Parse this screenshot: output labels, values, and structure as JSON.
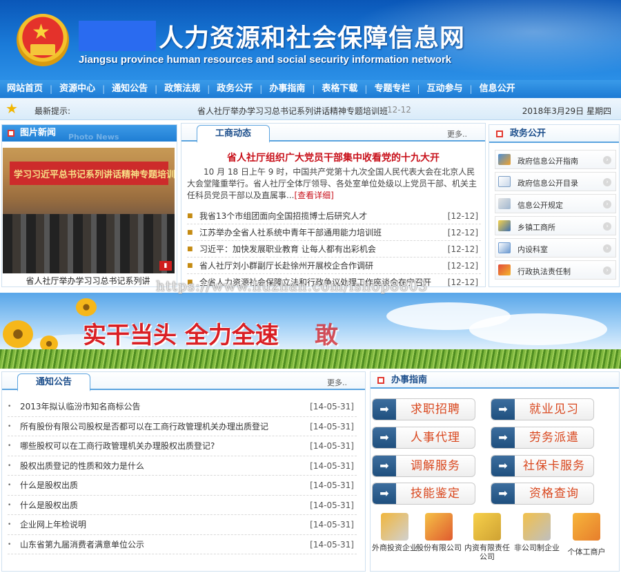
{
  "header": {
    "title": "人力资源和社会保障信息网",
    "subtitle": "Jiangsu province human resources and social security information network"
  },
  "nav": [
    "网站首页",
    "资源中心",
    "通知公告",
    "政策法规",
    "政务公开",
    "办事指南",
    "表格下载",
    "专题专栏",
    "互动参与",
    "信息公开"
  ],
  "ticker": {
    "label": "最新提示:",
    "news": "省人社厅举办学习习总书记系列讲话精神专题培训班",
    "news_date": "12-12",
    "today": "2018年3月29日 星期四"
  },
  "photo_news": {
    "title": "图片新闻",
    "title_en": "Photo News",
    "banner_text": "学习习近平总书记系列讲话精神专题培训班",
    "caption": "省人社厅举办学习习总书记系列讲"
  },
  "gongshang": {
    "title": "工商动态",
    "more": "更多..",
    "headline": "省人社厅组织广大党员干部集中收看党的十九大开",
    "summary": "10 月 18 日上午 9 时，中国共产党第十九次全国人民代表大会在北京人民大会堂隆重举行。省人社厅全体厅领导、各处室单位处级以上党员干部、机关主任科员党员干部以及直属事...",
    "detail": "[查看详细]",
    "items": [
      {
        "title": "我省13个市组团面向全国招揽博士后研究人才",
        "date": "[12-12]"
      },
      {
        "title": "江苏举办全省人社系统中青年干部通用能力培训班",
        "date": "[12-12]"
      },
      {
        "title": "习近平：加快发展职业教育 让每人都有出彩机会",
        "date": "[12-12]"
      },
      {
        "title": "省人社厅刘小群副厅长赴徐州开展校企合作调研",
        "date": "[12-12]"
      },
      {
        "title": "全省人力资源社会保障立法和行政争议处理工作座谈会在宁召开",
        "date": "[12-12]"
      }
    ]
  },
  "zhengwu": {
    "title": "政务公开",
    "items": [
      "政府信息公开指南",
      "政府信息公开目录",
      "信息公开规定",
      "乡镇工商所",
      "内设科室",
      "行政执法责任制"
    ]
  },
  "watermark": "https://www.huzhan.com/ishop8803",
  "banner": {
    "slogan": "实干当头 全力全速",
    "slogan_tail": "敢"
  },
  "notice": {
    "title": "通知公告",
    "more": "更多..",
    "items": [
      {
        "title": "2013年拟认临汾市知名商标公告",
        "date": "[14-05-31]"
      },
      {
        "title": "所有股份有限公司股权是否都可以在工商行政管理机关办理出质登记",
        "date": "[14-05-31]"
      },
      {
        "title": "哪些股权可以在工商行政管理机关办理股权出质登记?",
        "date": "[14-05-31]"
      },
      {
        "title": "股权出质登记的性质和效力是什么",
        "date": "[14-05-31]"
      },
      {
        "title": "什么是股权出质",
        "date": "[14-05-31]"
      },
      {
        "title": "什么是股权出质",
        "date": "[14-05-31]"
      },
      {
        "title": "企业网上年检说明",
        "date": "[14-05-31]"
      },
      {
        "title": "山东省第九届消费者满意单位公示",
        "date": "[14-05-31]"
      }
    ]
  },
  "guide": {
    "title": "办事指南",
    "buttons": [
      "求职招聘",
      "就业见习",
      "人事代理",
      "劳务派遣",
      "调解服务",
      "社保卡服务",
      "技能鉴定",
      "资格查询"
    ],
    "entities": [
      "外商投资企业",
      "股份有限公司",
      "内资有限责任公司",
      "非公司制企业",
      "个体工商户"
    ]
  },
  "colors": {
    "header_blue": "#0a57b8",
    "nav_blue": "#1c7ad4",
    "headline_red": "#c8101a",
    "button_text": "#d9471e"
  }
}
